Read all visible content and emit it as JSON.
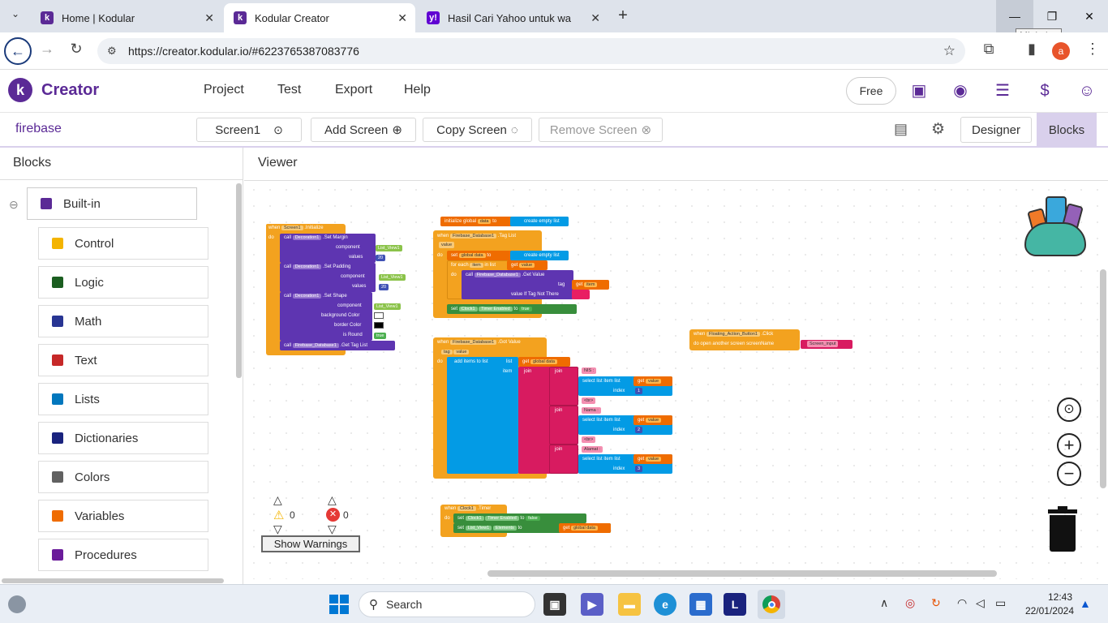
{
  "browser": {
    "tabs": [
      {
        "title": "Home | Kodular",
        "close": "✕"
      },
      {
        "title": "Kodular Creator",
        "close": "✕"
      },
      {
        "title": "Hasil Cari Yahoo untuk wa",
        "close": "✕"
      }
    ],
    "new_tab": "+",
    "tooltip": "Minimize",
    "url": "https://creator.kodular.io/#6223765387083776",
    "profile_initial": "a"
  },
  "app": {
    "brand": "Creator",
    "menu": [
      "Project",
      "Test",
      "Export",
      "Help"
    ],
    "free_label": "Free"
  },
  "toolbar": {
    "project_name": "firebase",
    "screen": "Screen1",
    "add_screen": "Add Screen",
    "copy_screen": "Copy Screen",
    "remove_screen": "Remove Screen",
    "designer": "Designer",
    "blocks": "Blocks"
  },
  "left": {
    "title": "Blocks",
    "builtin": "Built-in",
    "categories": [
      {
        "label": "Control",
        "color": "#f4b400"
      },
      {
        "label": "Logic",
        "color": "#1b5e20"
      },
      {
        "label": "Math",
        "color": "#283593"
      },
      {
        "label": "Text",
        "color": "#c62828"
      },
      {
        "label": "Lists",
        "color": "#0277bd"
      },
      {
        "label": "Dictionaries",
        "color": "#1a237e"
      },
      {
        "label": "Colors",
        "color": "#616161"
      },
      {
        "label": "Variables",
        "color": "#ef6c00"
      },
      {
        "label": "Procedures",
        "color": "#6a1b9a"
      }
    ]
  },
  "viewer": {
    "title": "Viewer",
    "warnings_count": "0",
    "errors_count": "0",
    "show_warnings": "Show Warnings"
  },
  "blocks": {
    "init": {
      "when": "when",
      "comp": "Screen1",
      "event": ".Initialize",
      "do": "do"
    },
    "init_stmts": [
      {
        "call": "call",
        "comp": "Decoration1",
        "method": ".Set Margin",
        "p1": "component",
        "v1": "List_View1",
        "p2": "values",
        "v2": "20"
      },
      {
        "call": "call",
        "comp": "Decoration1",
        "method": ".Set Padding",
        "p1": "component",
        "v1": "List_View1",
        "p2": "values",
        "v2": "20"
      },
      {
        "call": "call",
        "comp": "Decoration1",
        "method": ".Set Shape",
        "p1": "component",
        "v1": "List_View1",
        "p2": "background Color",
        "p3": "border Color",
        "p4": "is Round",
        "v4": "true"
      },
      {
        "call": "call",
        "comp": "Firebase_Database1",
        "method": ".Get Tag List"
      }
    ],
    "global": {
      "label": "initialize global",
      "name": "data",
      "to": "to",
      "value": "create empty list"
    },
    "taglist": {
      "when": "when",
      "comp": "Firebase_Database1",
      "event": ".Tag List",
      "param": "value",
      "do": "do",
      "set": "set",
      "var": "global data",
      "to": "to",
      "empty": "create empty list",
      "foreach": "for each",
      "item": "item",
      "inlist": "in list",
      "get": "get",
      "value": "value",
      "call": "call",
      "method": ".Get Value",
      "tag": "tag",
      "getitem": "item",
      "notthere": "value If Tag Not There",
      "setclock": "Clock1",
      "enabled": "Timer Enabled",
      "true": "true"
    },
    "gotvalue": {
      "when": "when",
      "comp": "Firebase_Database1",
      "event": ".Got Value",
      "tag": "tag",
      "value": "value",
      "do": "do",
      "additems": "add items to list",
      "list": "list",
      "item": "item",
      "getdata": "global data",
      "join": "join",
      "nis": "NIS :",
      "br": "<br>",
      "nama": "Nama :",
      "alamat": "Alamat :",
      "sel": "select list item  list",
      "index": "index",
      "i1": "1",
      "i2": "2",
      "i3": "3"
    },
    "fab": {
      "when": "when",
      "comp": "Floating_Action_Button1",
      "event": ".Click",
      "do": "do",
      "open": "open another screen  screenName",
      "screen": "Screen_input"
    },
    "timer": {
      "when": "when",
      "comp": "Clock1",
      "event": ".Timer",
      "do": "do",
      "enabled": "Timer Enabled",
      "false": "false",
      "lv": "List_View1",
      "elements": "Elements",
      "data": "global data"
    }
  },
  "taskbar": {
    "search": "Search",
    "time": "12:43",
    "date": "22/01/2024"
  }
}
